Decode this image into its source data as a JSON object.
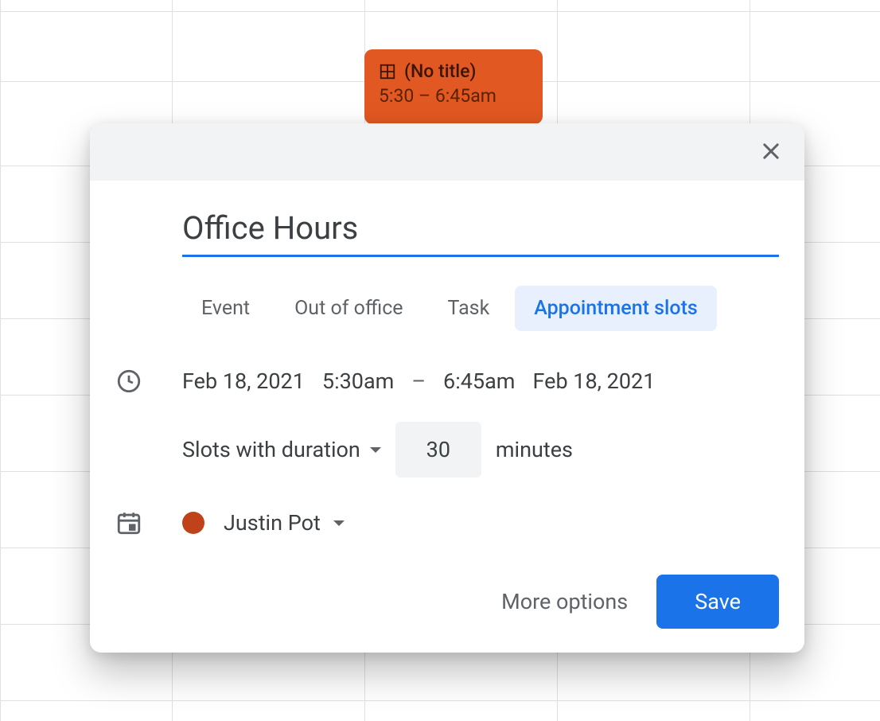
{
  "event_chip": {
    "title": "(No title)",
    "time": "5:30 – 6:45am"
  },
  "modal": {
    "title": "Office Hours",
    "tabs": [
      {
        "label": "Event",
        "active": false
      },
      {
        "label": "Out of office",
        "active": false
      },
      {
        "label": "Task",
        "active": false
      },
      {
        "label": "Appointment slots",
        "active": true
      }
    ],
    "time_row": {
      "start_date": "Feb 18, 2021",
      "start_time": "5:30am",
      "dash": "–",
      "end_time": "6:45am",
      "end_date": "Feb 18, 2021"
    },
    "duration": {
      "label": "Slots with duration",
      "value": "30",
      "unit": "minutes"
    },
    "calendar": {
      "name": "Justin Pot",
      "color": "#c0421a"
    },
    "footer": {
      "more_options": "More options",
      "save": "Save"
    }
  }
}
